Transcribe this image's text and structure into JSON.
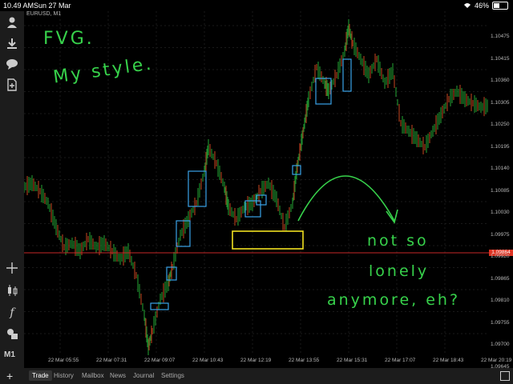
{
  "status": {
    "time": "10.49 AM",
    "date": "Sun 27 Mar",
    "battery": "46%",
    "battery_level": 0.46
  },
  "chart_header": {
    "symbol": "EURUSD, M1"
  },
  "price_axis": [
    "1.10475",
    "1.10415",
    "1.10360",
    "1.10305",
    "1.10250",
    "1.10195",
    "1.10140",
    "1.10085",
    "1.10030",
    "1.09975",
    "1.09920",
    "1.09865",
    "1.09810",
    "1.09755",
    "1.09700",
    "1.09645"
  ],
  "current_price": "1.09864",
  "time_axis": [
    "22 Mar 05:55",
    "22 Mar 07:31",
    "22 Mar 09:07",
    "22 Mar 10:43",
    "22 Mar 12:19",
    "22 Mar 13:55",
    "22 Mar 15:31",
    "22 Mar 17:07",
    "22 Mar 18:43",
    "22 Mar 20:19"
  ],
  "sidebar": {
    "timeframe": "M1",
    "icons": [
      "person-icon",
      "download-icon",
      "chat-icon",
      "document-icon",
      "crosshair-icon",
      "candlestick-icon",
      "function-icon",
      "objects-icon"
    ]
  },
  "tabs": [
    {
      "label": "Trade",
      "active": true
    },
    {
      "label": "History"
    },
    {
      "label": "Mailbox"
    },
    {
      "label": "News"
    },
    {
      "label": "Journal"
    },
    {
      "label": "Settings"
    }
  ],
  "annotations": {
    "line1": "FVG.",
    "line2": "My style.",
    "line3": "not so",
    "line4": "lonely",
    "line5": "anymore, eh?"
  },
  "colors": {
    "handwriting": "#37d24b",
    "boxes": "#3aa3e8",
    "highlight": "#f0e020",
    "price_line": "#c62828",
    "arrow": "#37d24b"
  }
}
